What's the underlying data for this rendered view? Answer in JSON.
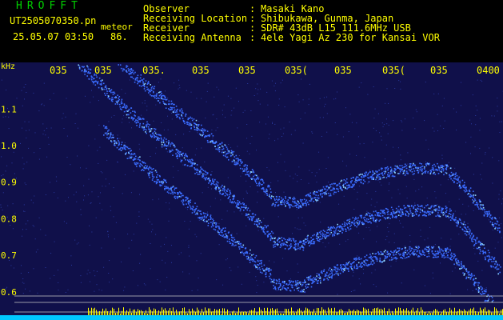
{
  "header": {
    "title": "HROFFT",
    "filename": "UT2505070350.pn",
    "mode_label": "meteor",
    "datetime": "25.05.07 03:50",
    "counter": "86.",
    "info": [
      {
        "key": "Observer",
        "value": "Masaki Kano"
      },
      {
        "key": "Receiving Location",
        "value": "Shibukawa, Gunma, Japan"
      },
      {
        "key": "Receiver",
        "value": "SDR# 43dB L15 111.6MHz USB"
      },
      {
        "key": "Receiving Antenna",
        "value": "4ele Yagi Az 230 for Kansai VOR"
      }
    ]
  },
  "spectrogram": {
    "unit_label": "kHz",
    "y_ticks": [
      "1.1",
      "1.0",
      "0.9",
      "0.8",
      "0.7",
      "0.6"
    ],
    "y_values": [
      1.1,
      1.0,
      0.9,
      0.8,
      0.7,
      0.6
    ],
    "ylim": [
      0.58,
      1.14
    ],
    "time_ticks": [
      "035",
      "035",
      "035.",
      "035",
      "035",
      "035(",
      "035",
      "035(",
      "035",
      "0400"
    ],
    "colors": {
      "background": "#10104a",
      "trace": "#3a6cff",
      "trace_hot": "#8fd8ff",
      "axis_text": "#ffff00",
      "baseline": "#00c8ff",
      "spikes": "#ffff00"
    }
  }
}
